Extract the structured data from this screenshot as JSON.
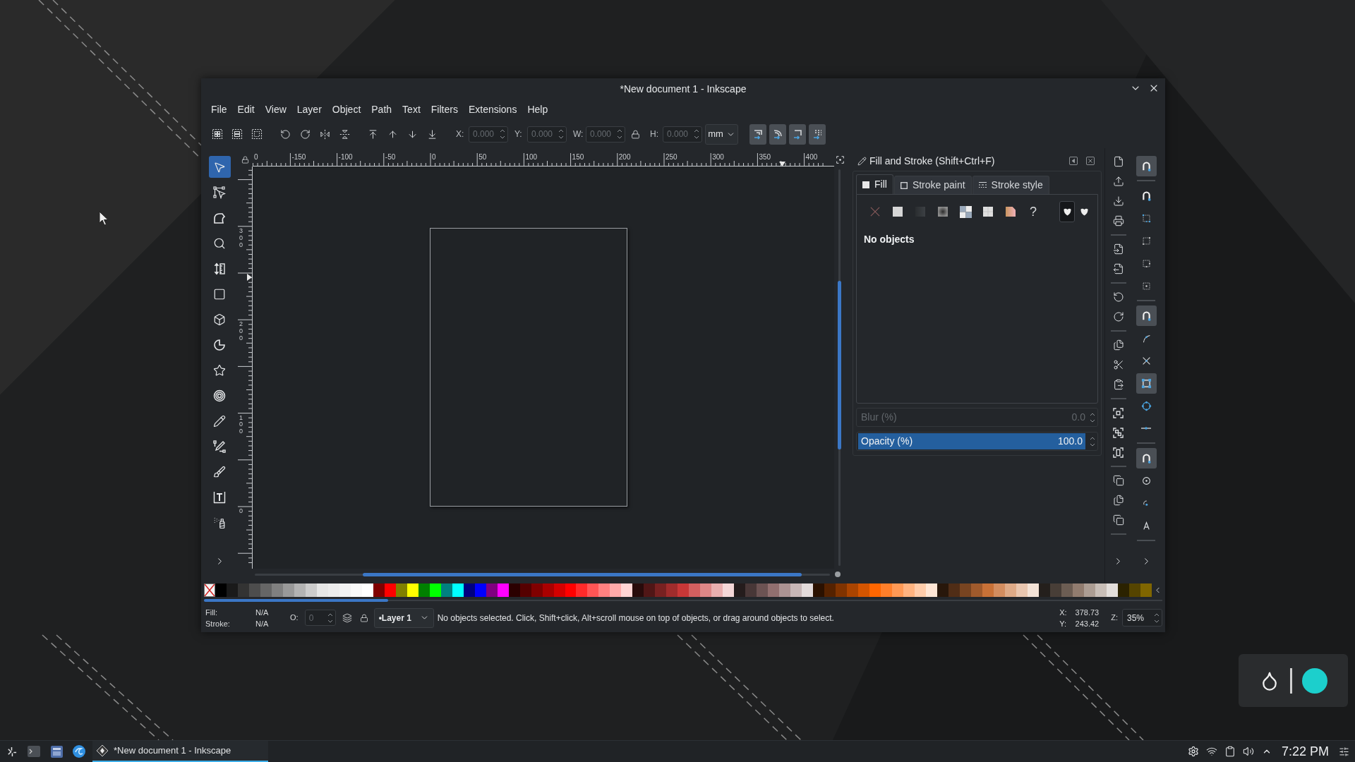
{
  "window": {
    "title": "*New document 1 - Inkscape"
  },
  "menu": [
    "File",
    "Edit",
    "View",
    "Layer",
    "Object",
    "Path",
    "Text",
    "Filters",
    "Extensions",
    "Help"
  ],
  "toolbar": {
    "coordinates": [
      {
        "label": "X:",
        "value": "0.000",
        "disabled": true
      },
      {
        "label": "Y:",
        "value": "0.000",
        "disabled": true
      },
      {
        "label": "W:",
        "value": "0.000",
        "disabled": true
      },
      {
        "label": "H:",
        "value": "0.000",
        "disabled": true
      }
    ],
    "unit": "mm",
    "transform_toggles": [
      {
        "on": true
      },
      {
        "on": true
      },
      {
        "on": true
      },
      {
        "on": true
      }
    ]
  },
  "tools": [
    {
      "selected": true
    },
    {
      "selected": false
    },
    {
      "selected": false
    },
    {
      "selected": false
    },
    {
      "selected": false
    },
    {
      "selected": false
    },
    {
      "selected": false
    },
    {
      "selected": false
    },
    {
      "selected": false
    },
    {
      "selected": false
    },
    {
      "selected": false
    },
    {
      "selected": false
    },
    {
      "selected": false
    },
    {
      "selected": false
    },
    {
      "selected": false
    }
  ],
  "rulers": {
    "horizontal": [
      "0",
      "-150",
      "-100",
      "-50",
      "0",
      "50",
      "100",
      "150",
      "200",
      "250",
      "300",
      "350",
      "400"
    ],
    "vertical": [
      "300",
      "200",
      "100",
      "0"
    ]
  },
  "fill_stroke": {
    "title": "Fill and Stroke (Shift+Ctrl+F)",
    "tabs": [
      {
        "label": "Fill",
        "selected": true
      },
      {
        "label": "Stroke paint",
        "selected": false
      },
      {
        "label": "Stroke style",
        "selected": false
      }
    ],
    "paint_types": [
      {
        "kind": "none",
        "selected": false
      },
      {
        "kind": "flat",
        "selected": false
      },
      {
        "kind": "linear",
        "selected": false
      },
      {
        "kind": "radial",
        "selected": false
      },
      {
        "kind": "mesh",
        "selected": false
      },
      {
        "kind": "pattern",
        "selected": false
      },
      {
        "kind": "swatch",
        "selected": false
      },
      {
        "kind": "unset",
        "label": "?",
        "selected": false
      }
    ],
    "fill_rules": [
      {
        "selected": true
      },
      {
        "selected": false
      }
    ],
    "message": "No objects",
    "blur": {
      "label": "Blur (%)",
      "value": "0.0",
      "disabled": true
    },
    "opacity": {
      "label": "Opacity (%)",
      "value": "100.0",
      "disabled": false,
      "level": 1
    }
  },
  "snap_groups": [
    {
      "items": [
        {
          "on": true
        }
      ]
    },
    {
      "items": [
        {
          "on": false
        },
        {
          "on": false
        },
        {
          "on": false
        },
        {
          "on": false
        },
        {
          "on": false
        }
      ]
    },
    {
      "items": [
        {
          "on": true
        },
        {
          "on": false
        },
        {
          "on": false
        },
        {
          "on": true
        },
        {
          "on": false
        },
        {
          "on": false
        }
      ]
    },
    {
      "items": [
        {
          "on": true
        },
        {
          "on": false
        },
        {
          "on": false
        },
        {
          "on": false
        }
      ]
    }
  ],
  "palette": {
    "swatches": [
      {
        "kind": "none"
      },
      {
        "kind": "color",
        "color": "#000000"
      },
      {
        "kind": "color",
        "color": "#1a1a1a"
      },
      {
        "kind": "color",
        "color": "#333333"
      },
      {
        "kind": "color",
        "color": "#4d4d4d"
      },
      {
        "kind": "color",
        "color": "#666666"
      },
      {
        "kind": "color",
        "color": "#808080"
      },
      {
        "kind": "color",
        "color": "#999999"
      },
      {
        "kind": "color",
        "color": "#b3b3b3"
      },
      {
        "kind": "color",
        "color": "#cccccc"
      },
      {
        "kind": "color",
        "color": "#e6e6e6"
      },
      {
        "kind": "color",
        "color": "#ececec"
      },
      {
        "kind": "color",
        "color": "#f2f2f2"
      },
      {
        "kind": "color",
        "color": "#f9f9f9"
      },
      {
        "kind": "color",
        "color": "#ffffff"
      },
      {
        "kind": "color",
        "color": "#800000"
      },
      {
        "kind": "color",
        "color": "#ff0000"
      },
      {
        "kind": "color",
        "color": "#808000"
      },
      {
        "kind": "color",
        "color": "#ffff00"
      },
      {
        "kind": "color",
        "color": "#008000"
      },
      {
        "kind": "color",
        "color": "#00ff00"
      },
      {
        "kind": "color",
        "color": "#008080"
      },
      {
        "kind": "color",
        "color": "#00ffff"
      },
      {
        "kind": "color",
        "color": "#000080"
      },
      {
        "kind": "color",
        "color": "#0000ff"
      },
      {
        "kind": "color",
        "color": "#800080"
      },
      {
        "kind": "color",
        "color": "#ff00ff"
      },
      {
        "kind": "color",
        "color": "#2b0000"
      },
      {
        "kind": "color",
        "color": "#550000"
      },
      {
        "kind": "color",
        "color": "#800000"
      },
      {
        "kind": "color",
        "color": "#aa0000"
      },
      {
        "kind": "color",
        "color": "#d40000"
      },
      {
        "kind": "color",
        "color": "#ff0000"
      },
      {
        "kind": "color",
        "color": "#ff2a2a"
      },
      {
        "kind": "color",
        "color": "#ff5555"
      },
      {
        "kind": "color",
        "color": "#ff8080"
      },
      {
        "kind": "color",
        "color": "#ffaaaa"
      },
      {
        "kind": "color",
        "color": "#ffd5d5"
      },
      {
        "kind": "color",
        "color": "#280b0b"
      },
      {
        "kind": "color",
        "color": "#501616"
      },
      {
        "kind": "color",
        "color": "#782121"
      },
      {
        "kind": "color",
        "color": "#a02c2c"
      },
      {
        "kind": "color",
        "color": "#c83737"
      },
      {
        "kind": "color",
        "color": "#d35f5f"
      },
      {
        "kind": "color",
        "color": "#de8787"
      },
      {
        "kind": "color",
        "color": "#e9afaf"
      },
      {
        "kind": "color",
        "color": "#f4d7d7"
      },
      {
        "kind": "color",
        "color": "#241c1c"
      },
      {
        "kind": "color",
        "color": "#483737"
      },
      {
        "kind": "color",
        "color": "#6c5353"
      },
      {
        "kind": "color",
        "color": "#916f6f"
      },
      {
        "kind": "color",
        "color": "#ac9393"
      },
      {
        "kind": "color",
        "color": "#c8b7b7"
      },
      {
        "kind": "color",
        "color": "#e3dbdb"
      },
      {
        "kind": "color",
        "color": "#2b1100"
      },
      {
        "kind": "color",
        "color": "#552200"
      },
      {
        "kind": "color",
        "color": "#803300"
      },
      {
        "kind": "color",
        "color": "#aa4400"
      },
      {
        "kind": "color",
        "color": "#d45500"
      },
      {
        "kind": "color",
        "color": "#ff6600"
      },
      {
        "kind": "color",
        "color": "#ff7f2a"
      },
      {
        "kind": "color",
        "color": "#ff9955"
      },
      {
        "kind": "color",
        "color": "#ffb380"
      },
      {
        "kind": "color",
        "color": "#ffccaa"
      },
      {
        "kind": "color",
        "color": "#ffe6d5"
      },
      {
        "kind": "color",
        "color": "#28170b"
      },
      {
        "kind": "color",
        "color": "#502d16"
      },
      {
        "kind": "color",
        "color": "#784421"
      },
      {
        "kind": "color",
        "color": "#a05a2c"
      },
      {
        "kind": "color",
        "color": "#c87137"
      },
      {
        "kind": "color",
        "color": "#d38d5f"
      },
      {
        "kind": "color",
        "color": "#deaa87"
      },
      {
        "kind": "color",
        "color": "#e9c6af"
      },
      {
        "kind": "color",
        "color": "#f4e3d7"
      },
      {
        "kind": "color",
        "color": "#241f1c"
      },
      {
        "kind": "color",
        "color": "#483e37"
      },
      {
        "kind": "color",
        "color": "#6c5d53"
      },
      {
        "kind": "color",
        "color": "#917c6f"
      },
      {
        "kind": "color",
        "color": "#ac9d93"
      },
      {
        "kind": "color",
        "color": "#c8beb7"
      },
      {
        "kind": "color",
        "color": "#e3dedb"
      },
      {
        "kind": "color",
        "color": "#2b2200"
      },
      {
        "kind": "color",
        "color": "#554400"
      },
      {
        "kind": "color",
        "color": "#806600"
      }
    ]
  },
  "status_bar": {
    "fill": {
      "label": "Fill:",
      "value": "N/A"
    },
    "stroke": {
      "label": "Stroke:",
      "value": "N/A"
    },
    "opacity": {
      "label": "O:",
      "value": "0",
      "disabled": true
    },
    "layer": "•Layer 1",
    "message": "No objects selected. Click, Shift+click, Alt+scroll mouse on top of objects, or drag around objects to select.",
    "cursor_x": {
      "label": "X:",
      "value": "378.73"
    },
    "cursor_y": {
      "label": "Y:",
      "value": "243.42"
    },
    "zoom": {
      "label": "Z:",
      "value": "35%"
    }
  },
  "taskbar": {
    "tasks": [
      {
        "title": "*New document 1 - Inkscape",
        "selected": true
      }
    ],
    "clock": "7:22 PM"
  }
}
